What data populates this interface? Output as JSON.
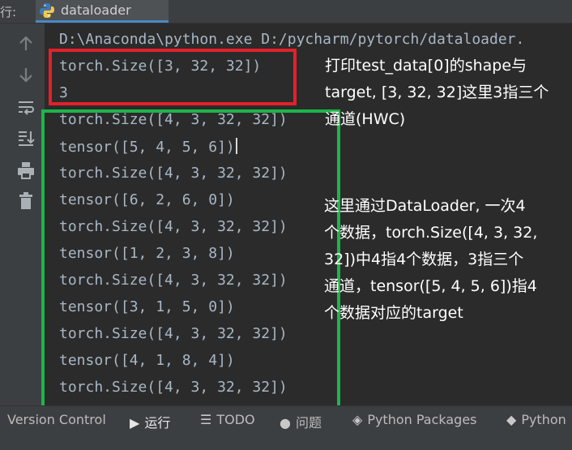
{
  "run_prefix": "行:",
  "tab": {
    "label": "dataloader"
  },
  "console": {
    "command": "D:\\Anaconda\\python.exe D:/pycharm/pytorch/dataloader.",
    "lines": [
      "torch.Size([3, 32, 32])",
      "3",
      "torch.Size([4, 3, 32, 32])",
      "tensor([5, 4, 5, 6])",
      "torch.Size([4, 3, 32, 32])",
      "tensor([6, 2, 6, 0])",
      "torch.Size([4, 3, 32, 32])",
      "tensor([1, 2, 3, 8])",
      "torch.Size([4, 3, 32, 32])",
      "tensor([3, 1, 5, 0])",
      "torch.Size([4, 3, 32, 32])",
      "tensor([4, 1, 8, 4])",
      "torch.Size([4, 3, 32, 32])"
    ]
  },
  "annotations": {
    "red_note": [
      "打印test_data[0]的shape与",
      "target, [3, 32, 32]这里3指三个",
      "通道(HWC)"
    ],
    "green_note": [
      "这里通过DataLoader, 一次4",
      "个数据，torch.Size([4, 3, 32,",
      "32])中4指4个数据，3指三个",
      "通道，tensor([5, 4, 5, 6])指4",
      "个数据对应的target"
    ]
  },
  "colors": {
    "red_box": "#e3212a",
    "green_box": "#1db54b",
    "tab_underline": "#4a88c7"
  },
  "bottom_bar": [
    {
      "label": "Version Control",
      "icon": ""
    },
    {
      "label": "运行",
      "icon": "play-icon"
    },
    {
      "label": "TODO",
      "icon": "list-icon"
    },
    {
      "label": "问题",
      "icon": "info-icon"
    },
    {
      "label": "Python Packages",
      "icon": "layers-icon"
    },
    {
      "label": "Python",
      "icon": "python-icon"
    }
  ]
}
